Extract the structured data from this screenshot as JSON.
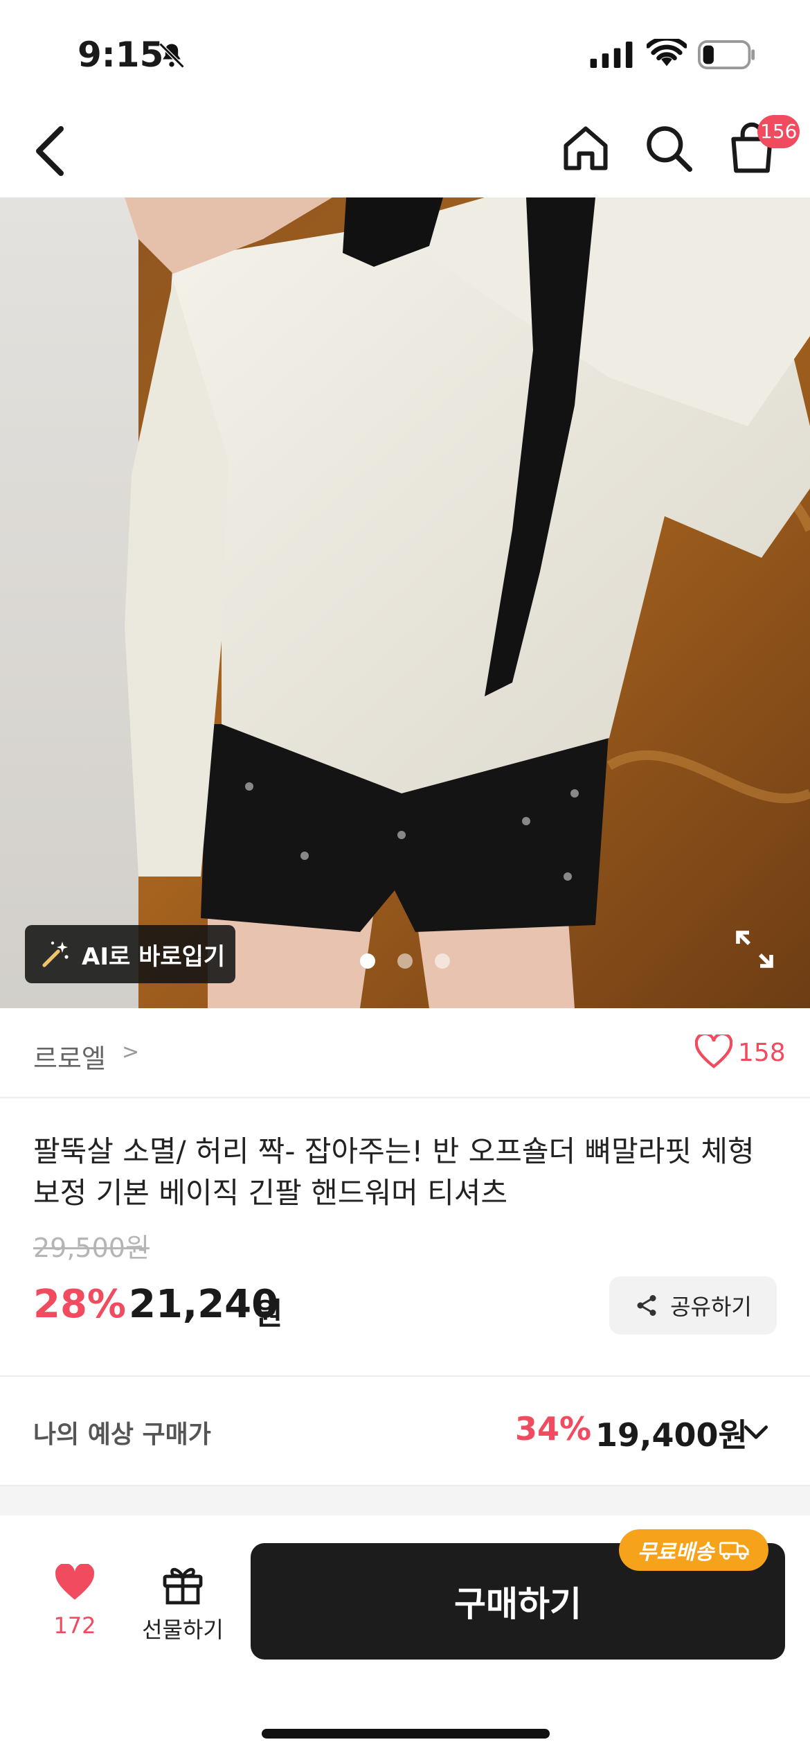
{
  "status_bar": {
    "time": "9:15",
    "icons": [
      "bell-off-icon",
      "signal-icon",
      "wifi-icon",
      "battery-icon"
    ]
  },
  "header": {
    "icons": [
      "back-arrow-icon",
      "home-icon",
      "search-icon",
      "cart-icon"
    ],
    "cart_badge": "156"
  },
  "hero": {
    "ai_button_label": "AI로 바로입기",
    "pagination_total": 3,
    "pagination_active": 1
  },
  "brand": {
    "name": "르로엘",
    "chevron": ">",
    "like_count": "158"
  },
  "product": {
    "title": "팔뚝살 소멸/ 허리 짝- 잡아주는! 반 오프숄더 뼈말라핏 체형보정 기본 베이직 긴팔 핸드워머 티셔츠",
    "original_price": "29,500원",
    "discount_rate": "28%",
    "price": "21,240",
    "price_unit": "원",
    "share_label": "공유하기"
  },
  "expected_price": {
    "label": "나의 예상 구매가",
    "discount_rate": "34%",
    "price": "19,400원"
  },
  "bottom_bar": {
    "like_count": "172",
    "gift_label": "선물하기",
    "buy_label": "구매하기",
    "free_shipping_label": "무료배송"
  },
  "colors": {
    "accent_red": "#f04b5e",
    "free_shipping_orange": "#f7a21b",
    "buy_button": "#1c1c1c"
  }
}
